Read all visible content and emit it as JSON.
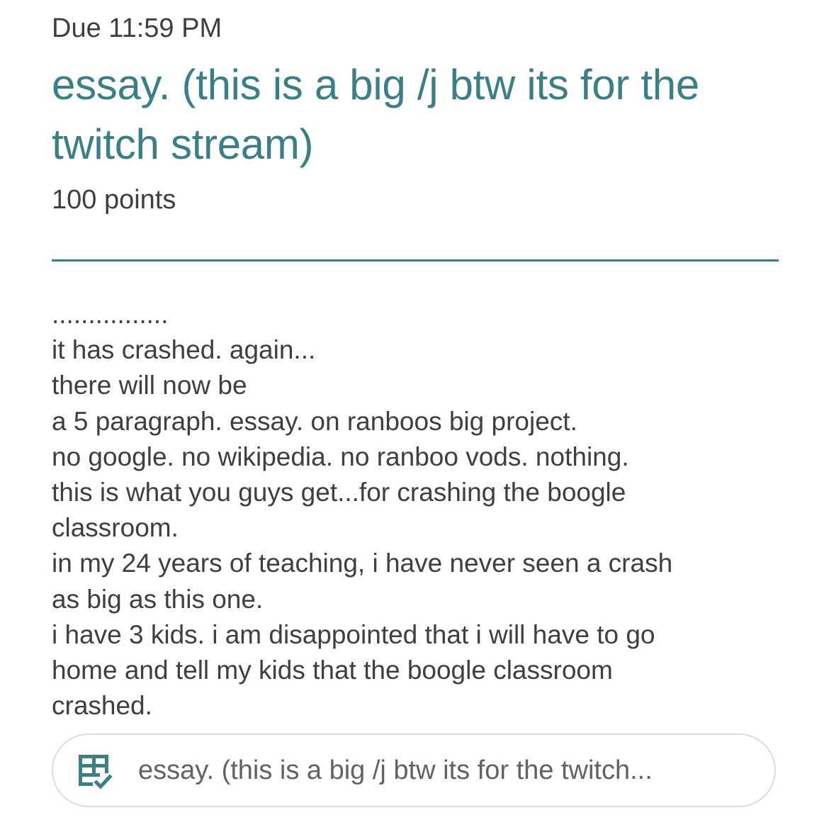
{
  "assignment": {
    "due": "Due 11:59 PM",
    "title_lines": [
      "essay. (this is a big /j btw its for the",
      "twitch stream)"
    ],
    "points": "100 points"
  },
  "instructions": {
    "lines": [
      "................",
      "it has crashed. again...",
      "there will now be",
      "a 5 paragraph. essay. on ranboos big project.",
      "no google. no wikipedia. no ranboo vods. nothing.",
      "this is what you guys get...for crashing the boogle",
      "classroom.",
      "in my 24 years of teaching, i have never seen a crash",
      "as big as this one.",
      "i have 3 kids. i am disappointed that i will have to go",
      "home and tell my kids that the boogle classroom",
      "crashed."
    ]
  },
  "attachment": {
    "icon": "assignment-form-icon",
    "label": "essay. (this is a big /j btw its for the twitch..."
  },
  "colors": {
    "accent": "#3a7e86",
    "text": "#3c4043",
    "muted": "#5f6368",
    "border": "#dadce0"
  }
}
